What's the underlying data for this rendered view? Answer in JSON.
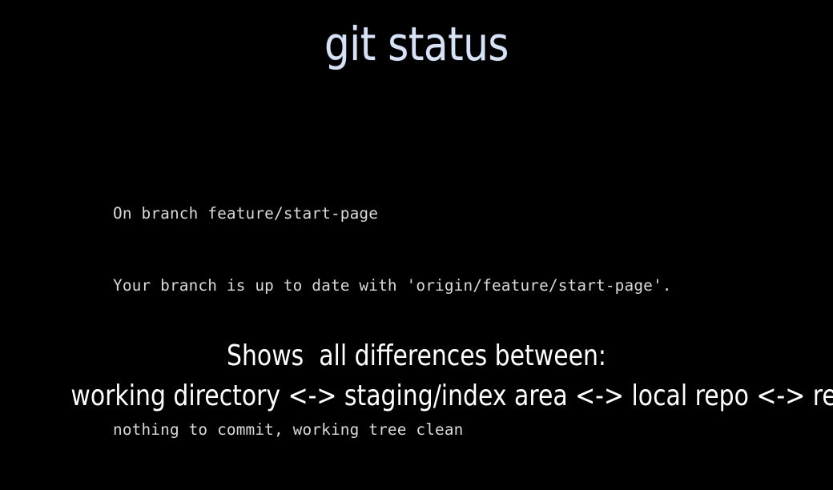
{
  "slide": {
    "background_color": "#000000",
    "title": "git status",
    "title_color": "#d7e2f7",
    "terminal": {
      "text_color": "#d9d9d9",
      "lines": [
        "On branch feature/start-page",
        "Your branch is up to date with 'origin/feature/start-page'.",
        "",
        "nothing to commit, working tree clean"
      ]
    },
    "caption": {
      "text_color": "#ffffff",
      "line1": "Shows  all differences between:",
      "line2": "working directory <-> staging/index area <-> local repo <-> remote repo"
    }
  }
}
